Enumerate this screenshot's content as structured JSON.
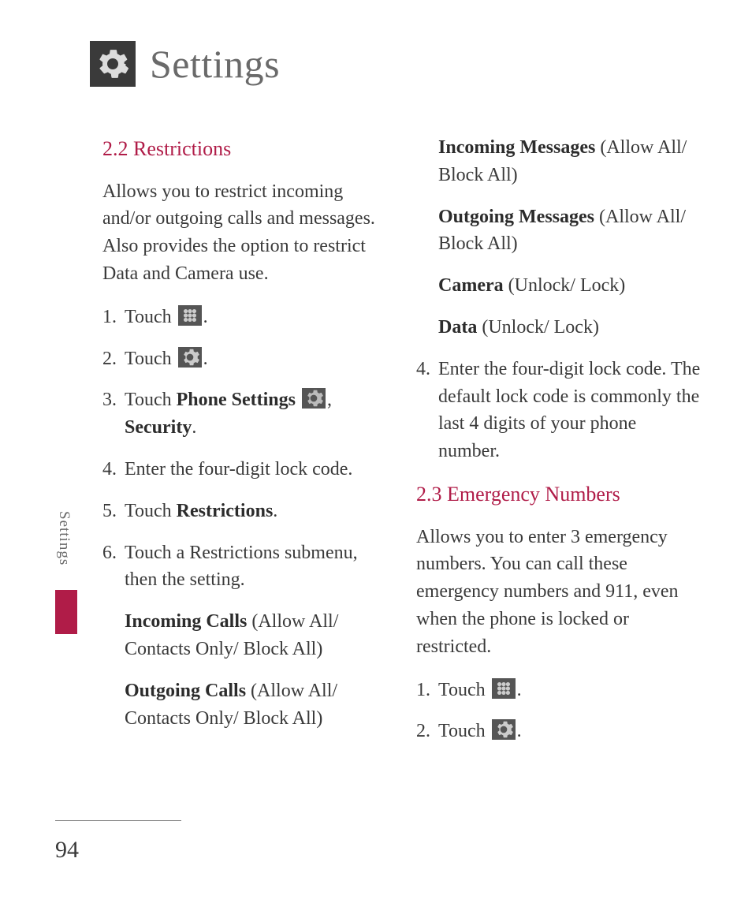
{
  "header": {
    "title": "Settings"
  },
  "side_label": "Settings",
  "page_number": "94",
  "left": {
    "h1": "2.2 Restrictions",
    "intro": "Allows you to restrict incoming and/or outgoing calls and messages. Also provides the option to restrict Data and Camera use.",
    "s1": {
      "n": "1.",
      "a": "Touch ",
      "b": "."
    },
    "s2": {
      "n": "2.",
      "a": "Touch ",
      "b": "."
    },
    "s3": {
      "n": "3.",
      "a": "Touch ",
      "b": "Phone Settings ",
      "c": ", ",
      "d": "Security",
      "e": "."
    },
    "s4": {
      "n": "4.",
      "a": "Enter the four-digit lock code."
    },
    "s5": {
      "n": "5.",
      "a": "Touch ",
      "b": "Restrictions",
      "c": "."
    },
    "s6": {
      "n": "6.",
      "a": "Touch a Restrictions submenu, then the setting."
    },
    "sub1": {
      "b": "Incoming Calls ",
      "a": "(Allow All/ Contacts Only/ Block All)"
    },
    "sub2": {
      "b": "Outgoing Calls ",
      "a": "(Allow All/ Contacts Only/ Block All)"
    }
  },
  "right": {
    "sub3": {
      "b": "Incoming Messages ",
      "a": "(Allow All/ Block All)"
    },
    "sub4": {
      "b": "Outgoing Messages ",
      "a": "(Allow All/ Block All)"
    },
    "sub5": {
      "b": "Camera ",
      "a": "(Unlock/ Lock)"
    },
    "sub6": {
      "b": "Data ",
      "a": "(Unlock/ Lock)"
    },
    "s4": {
      "n": "4.",
      "a": "Enter the four-digit lock code. The default lock code is commonly the last 4 digits of your phone number."
    },
    "h2": "2.3 Emergency Numbers",
    "intro2": "Allows you to enter 3 emergency numbers. You can call these emergency numbers and 911, even when the phone is locked or restricted.",
    "s1b": {
      "n": "1.",
      "a": "Touch ",
      "b": "."
    },
    "s2b": {
      "n": "2.",
      "a": "Touch ",
      "b": "."
    }
  }
}
